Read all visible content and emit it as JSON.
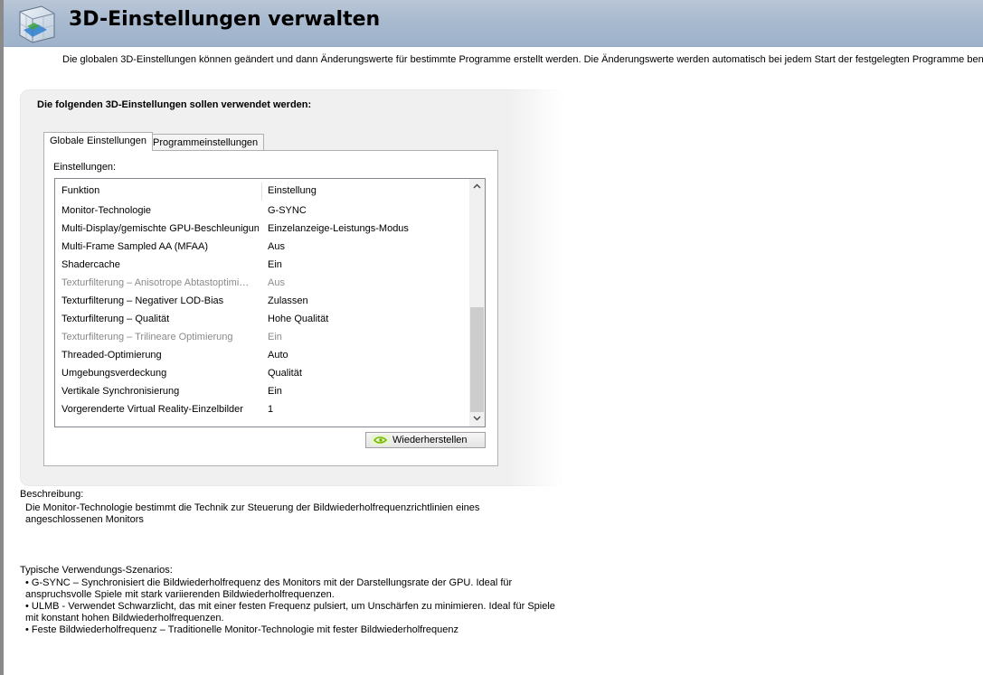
{
  "header": {
    "title": "3D-Einstellungen verwalten",
    "icon": "nvidia-3d-cube-icon"
  },
  "intro": "Die globalen 3D-Einstellungen können geändert und dann Änderungswerte für bestimmte Programme erstellt werden. Die Änderungswerte werden automatisch bei jedem Start der festgelegten Programme benutzt.",
  "panel": {
    "heading": "Die folgenden 3D-Einstellungen sollen verwendet werden:",
    "tabs": [
      {
        "label": "Globale Einstellungen",
        "active": true
      },
      {
        "label": "Programmeinstellungen",
        "active": false
      }
    ],
    "settings_label": "Einstellungen:",
    "columns": {
      "function": "Funktion",
      "setting": "Einstellung"
    },
    "rows": [
      {
        "function": "Monitor-Technologie",
        "setting": "G-SYNC",
        "disabled": false
      },
      {
        "function": "Multi-Display/gemischte GPU-Beschleunigung",
        "setting": "Einzelanzeige-Leistungs-Modus",
        "disabled": false
      },
      {
        "function": "Multi-Frame Sampled AA (MFAA)",
        "setting": "Aus",
        "disabled": false
      },
      {
        "function": "Shadercache",
        "setting": "Ein",
        "disabled": false
      },
      {
        "function": "Texturfilterung – Anisotrope Abtastoptimi…",
        "setting": "Aus",
        "disabled": true
      },
      {
        "function": "Texturfilterung – Negativer LOD-Bias",
        "setting": "Zulassen",
        "disabled": false
      },
      {
        "function": "Texturfilterung – Qualität",
        "setting": "Hohe Qualität",
        "disabled": false
      },
      {
        "function": "Texturfilterung – Trilineare Optimierung",
        "setting": "Ein",
        "disabled": true
      },
      {
        "function": "Threaded-Optimierung",
        "setting": "Auto",
        "disabled": false
      },
      {
        "function": "Umgebungsverdeckung",
        "setting": "Qualität",
        "disabled": false
      },
      {
        "function": "Vertikale Synchronisierung",
        "setting": "Ein",
        "disabled": false
      },
      {
        "function": "Vorgerenderte Virtual Reality-Einzelbilder",
        "setting": "1",
        "disabled": false
      }
    ],
    "restore_button": "Wiederherstellen"
  },
  "description": {
    "label": "Beschreibung:",
    "text": "Die Monitor-Technologie bestimmt die Technik zur Steuerung der Bildwiederholfrequenzrichtlinien eines angeschlossenen Monitors"
  },
  "usage": {
    "label": "Typische Verwendungs-Szenarios:",
    "items": [
      "G-SYNC – Synchronisiert die Bildwiederholfrequenz des Monitors mit der Darstellungsrate der GPU. Ideal für anspruchsvolle Spiele mit stark variierenden Bildwiederholfrequenzen.",
      "ULMB - Verwendet Schwarzlicht, das mit einer festen Frequenz pulsiert, um Unschärfen zu minimieren. Ideal für Spiele mit konstant hohen Bildwiederholfrequenzen.",
      "Feste Bildwiederholfrequenz – Traditionelle Monitor-Technologie mit fester Bildwiederholfrequenz"
    ]
  },
  "colors": {
    "header_bg": "#a6b8ce",
    "disabled_text": "#8a8a8a",
    "nvidia_green": "#76b900"
  }
}
